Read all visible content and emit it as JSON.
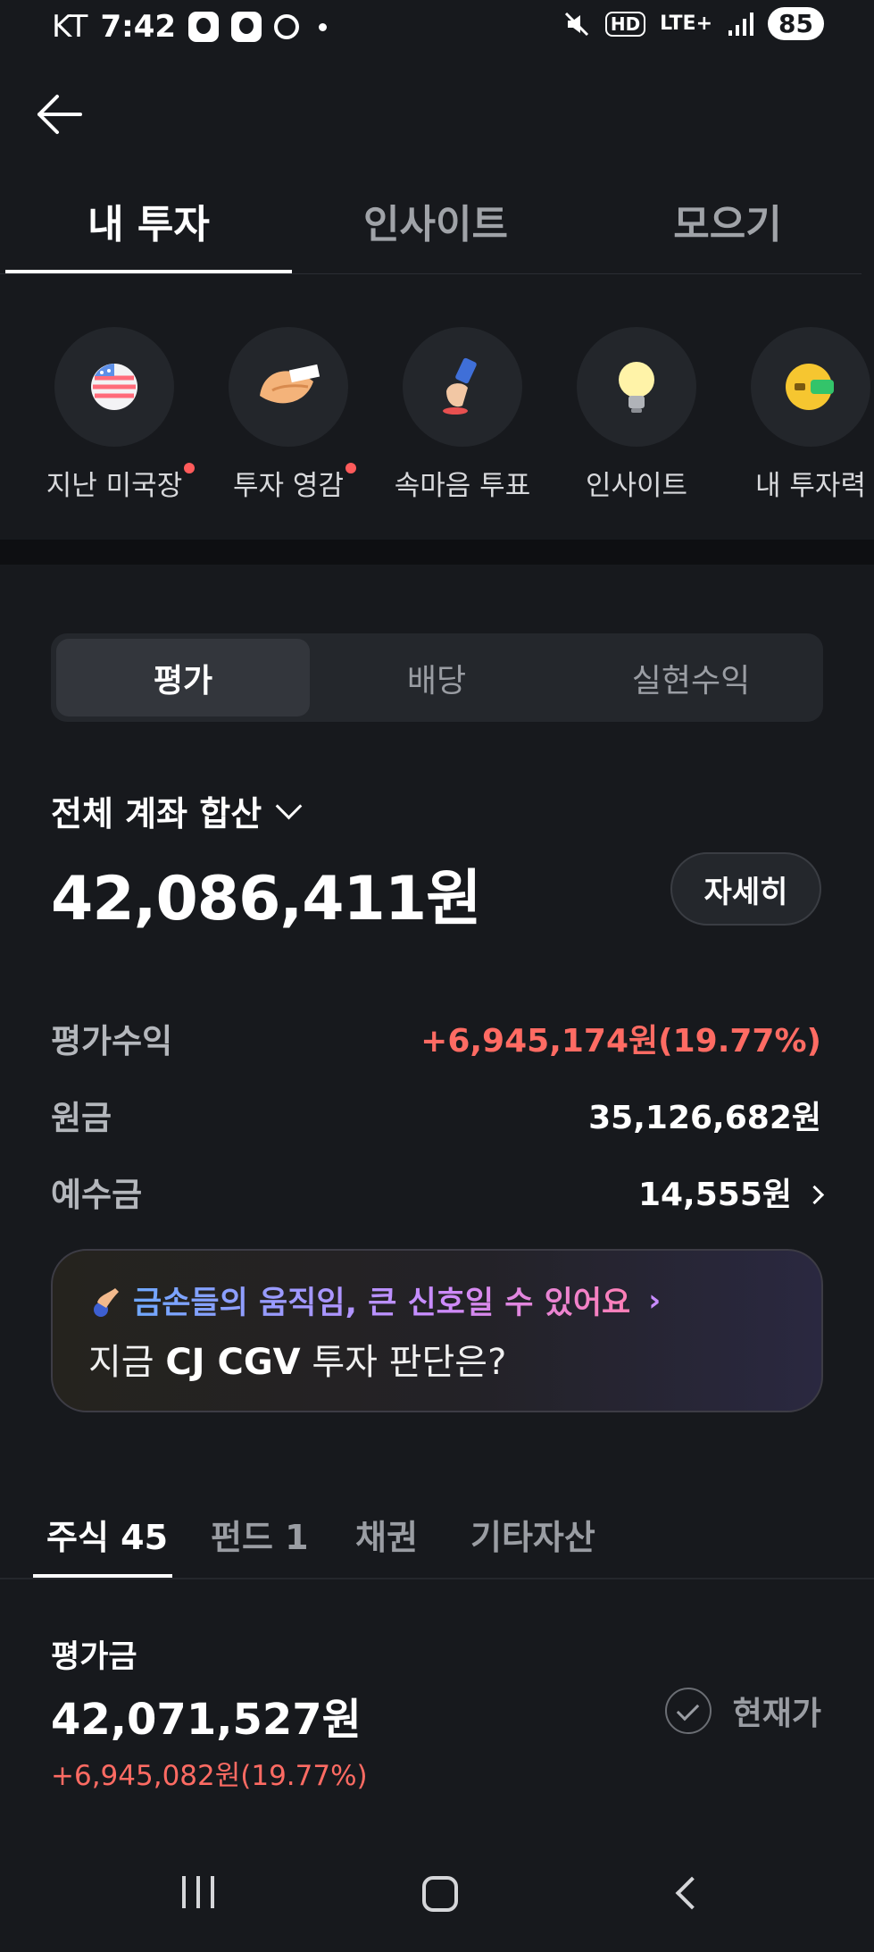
{
  "status_bar": {
    "carrier": "KT",
    "time": "7:42",
    "network": "LTE+",
    "hd": "HD",
    "battery": "85"
  },
  "tabs": [
    {
      "label": "내 투자",
      "active": true
    },
    {
      "label": "인사이트",
      "active": false
    },
    {
      "label": "모으기",
      "active": false
    }
  ],
  "shortcuts": [
    {
      "label": "지난 미국장",
      "icon": "us-flag-ball-icon",
      "badge": true
    },
    {
      "label": "투자 영감",
      "icon": "fortune-cookie-icon",
      "badge": true
    },
    {
      "label": "속마음 투표",
      "icon": "vote-stamp-icon",
      "badge": false
    },
    {
      "label": "인사이트",
      "icon": "lightbulb-icon",
      "badge": false
    },
    {
      "label": "내 투자력",
      "icon": "investment-power-icon",
      "badge": false
    }
  ],
  "segment": {
    "items": [
      "평가",
      "배당",
      "실현수익"
    ],
    "selected": "평가"
  },
  "account": {
    "title": "전체 계좌 합산",
    "total": "42,086,411원",
    "detail_button": "자세히"
  },
  "summary": {
    "profit_label": "평가수익",
    "profit_value": "+6,945,174원(19.77%)",
    "principal_label": "원금",
    "principal_value": "35,126,682원",
    "deposit_label": "예수금",
    "deposit_value": "14,555원"
  },
  "banner": {
    "headline": "금손들의 움직임, 큰 신호일 수 있어요",
    "question_prefix": "지금 ",
    "question_stock": "CJ CGV",
    "question_suffix": " 투자 판단은?"
  },
  "asset_tabs": [
    {
      "label": "주식 45",
      "active": true
    },
    {
      "label": "펀드 1",
      "active": false
    },
    {
      "label": "채권",
      "active": false
    },
    {
      "label": "기타자산",
      "active": false
    }
  ],
  "holdings": {
    "eval_label": "평가금",
    "eval_total": "42,071,527원",
    "eval_profit": "+6,945,082원(19.77%)",
    "current_price_label": "현재가"
  },
  "colors": {
    "background": "#17191d",
    "profit_red": "#ff6b63",
    "card": "#24272c"
  }
}
